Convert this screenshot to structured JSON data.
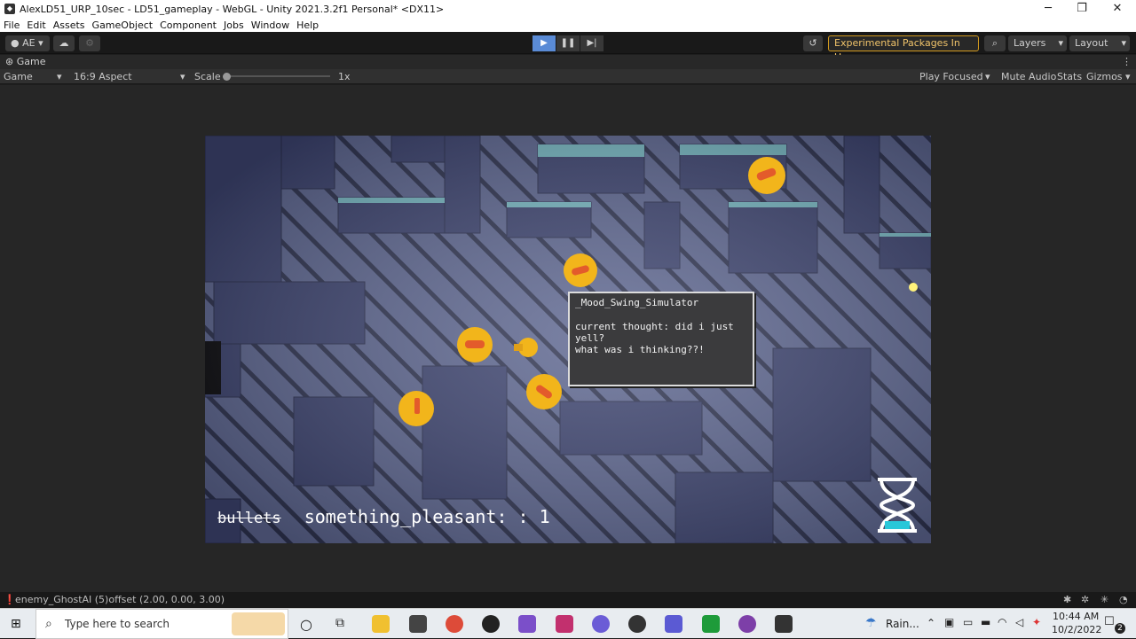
{
  "window": {
    "title": "AlexLD51_URP_10sec - LD51_gameplay - WebGL - Unity 2021.3.2f1 Personal* <DX11>",
    "minimize": "─",
    "maximize": "❐",
    "close": "✕"
  },
  "menu": [
    "File",
    "Edit",
    "Assets",
    "GameObject",
    "Component",
    "Jobs",
    "Window",
    "Help"
  ],
  "toolbar": {
    "account": "AE",
    "experimental": "Experimental Packages In Use",
    "layers": "Layers",
    "layout": "Layout"
  },
  "game_tab": {
    "label": "Game"
  },
  "game_bar": {
    "display": "Game",
    "aspect": "16:9 Aspect",
    "scale_label": "Scale",
    "scale_value": "1x",
    "play_mode": "Play Focused",
    "mute": "Mute Audio",
    "stats": "Stats",
    "gizmos": "Gizmos"
  },
  "game": {
    "dialog_title": "_Mood_Swing_Simulator",
    "dialog_line1": "current thought: did i just yell?",
    "dialog_line2": "what was i thinking??!",
    "hud_crossed": "bullets",
    "hud_text": "something_pleasant: : 1"
  },
  "status": {
    "message": "enemy_GhostAI (5)offset (2.00, 0.00, 3.00)"
  },
  "taskbar": {
    "search_placeholder": "Type here to search",
    "weather": "Rain...",
    "time": "10:44 AM",
    "date": "10/2/2022",
    "notifications": "2"
  },
  "colors": {
    "editor_bg": "#1e1e1e",
    "play_active": "#5a8bd6",
    "warning_border": "#d39a1e",
    "floor": "#5d6690",
    "wall": "#3c426a",
    "wall_top": "#76b6c1",
    "emoji": "#f2b51b"
  }
}
